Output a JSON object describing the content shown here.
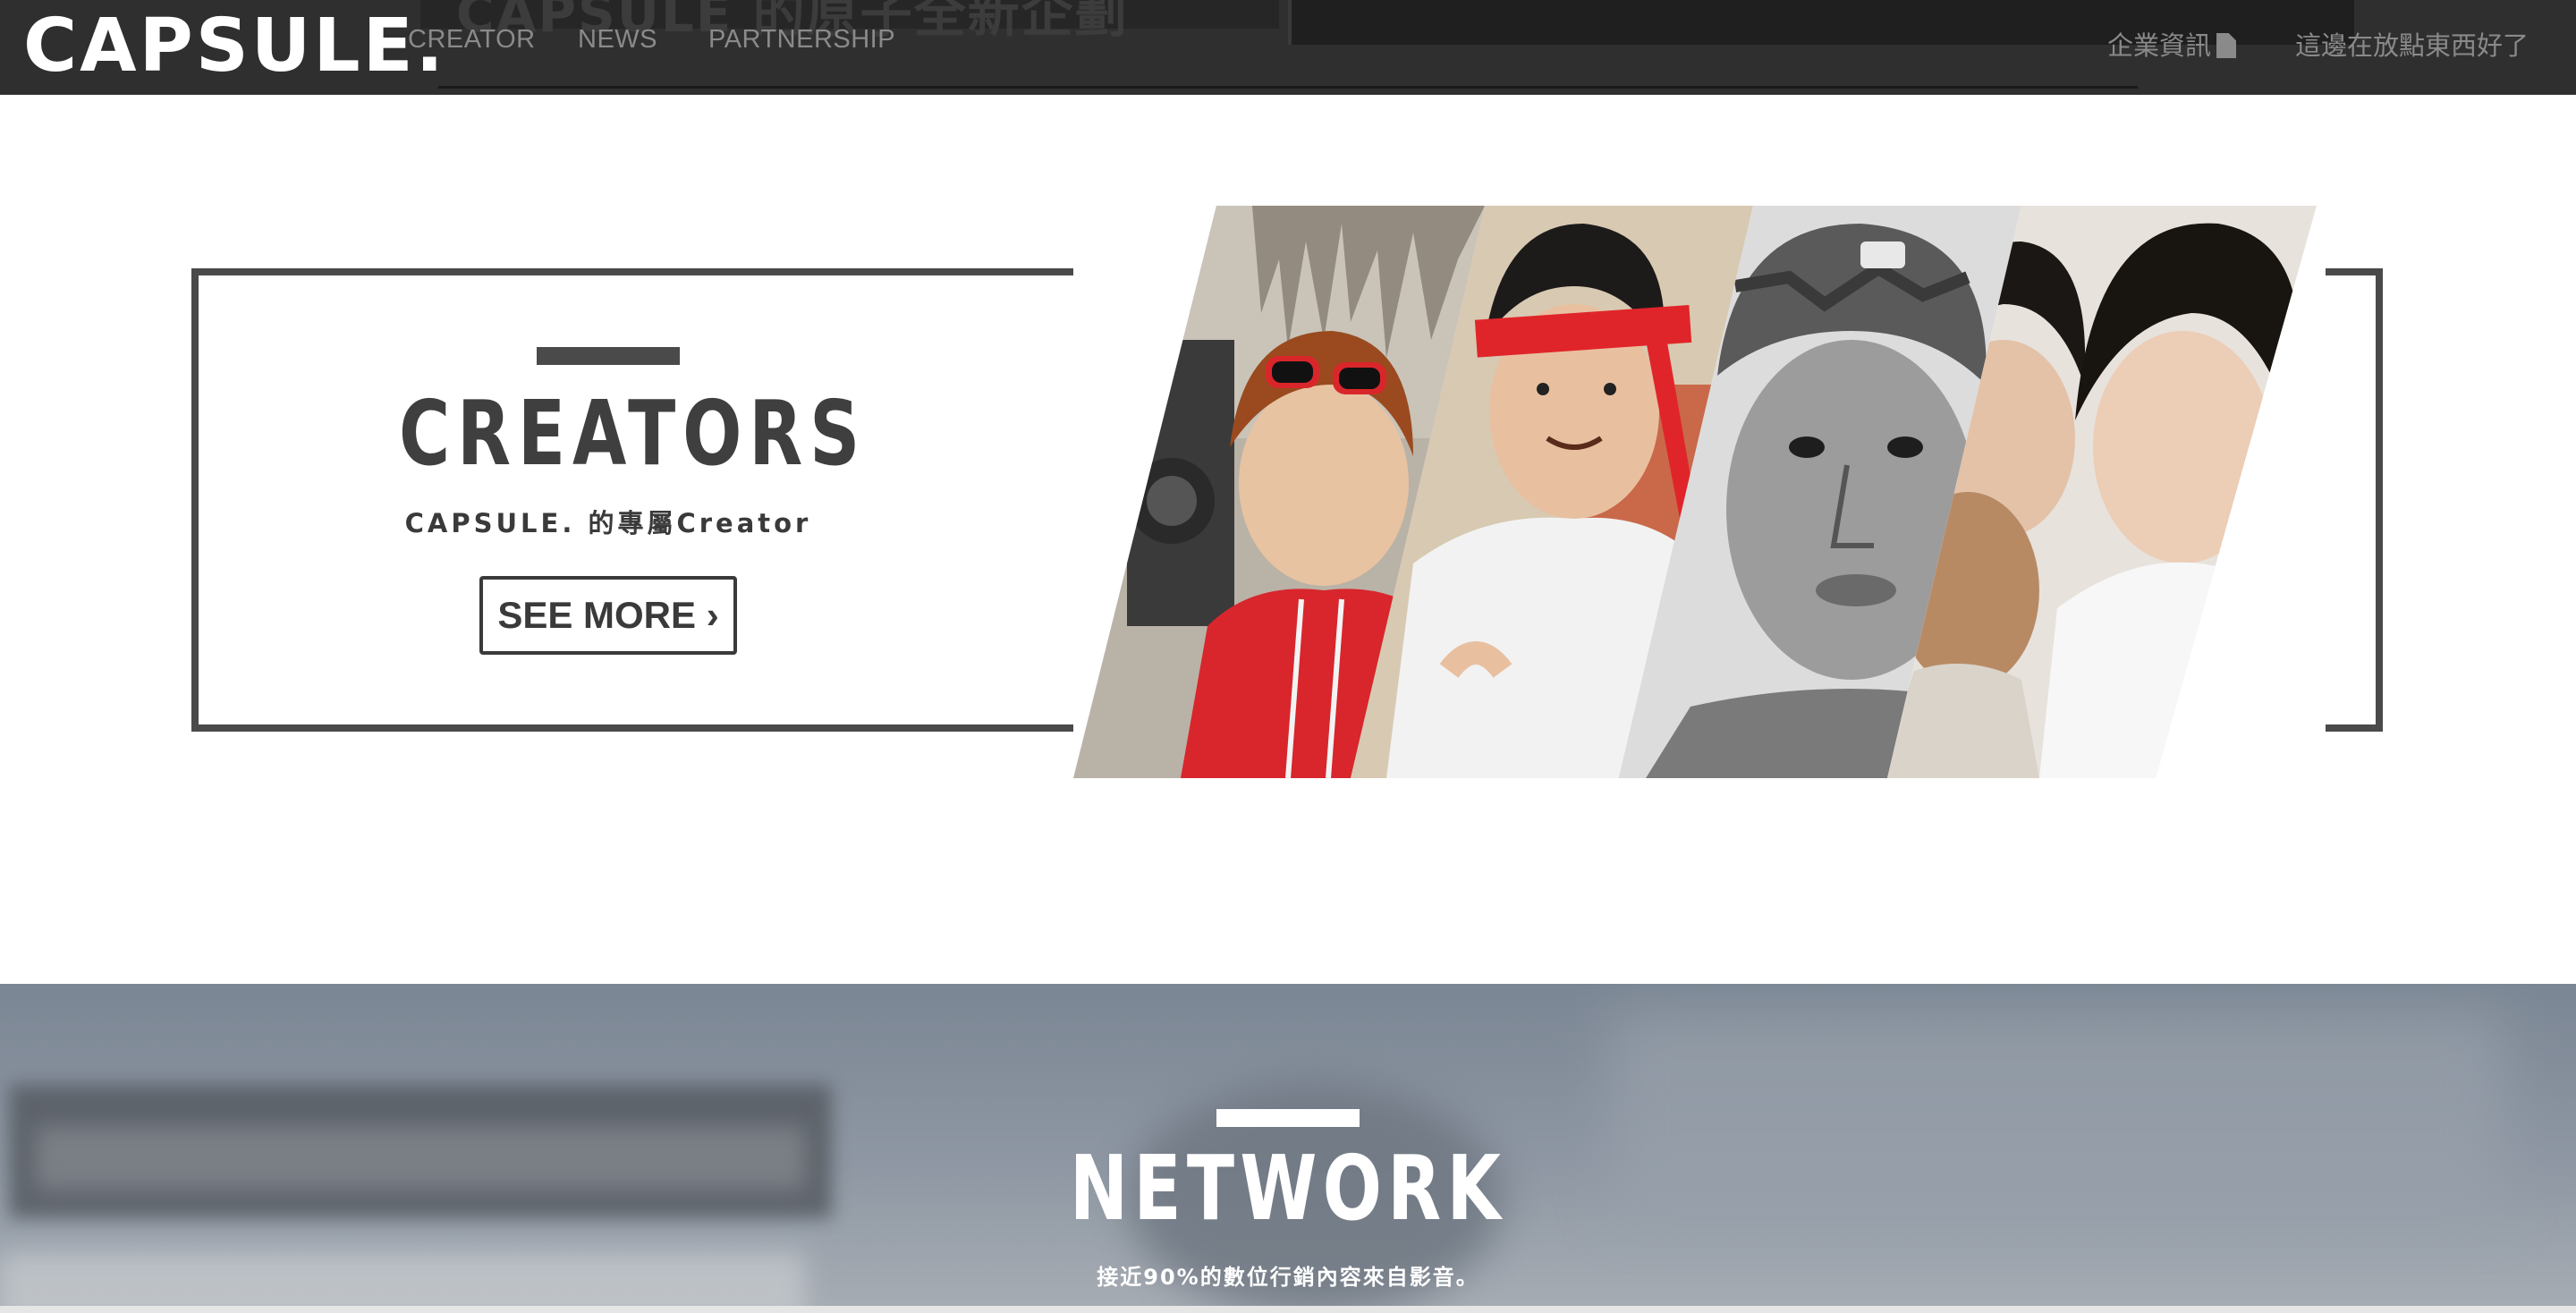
{
  "header": {
    "logo": "CAPSULE.",
    "nav": [
      "CREATOR",
      "NEWS",
      "PARTNERSHIP"
    ],
    "right_links": [
      "企業資訊",
      "這邊在放點東西好了"
    ],
    "banner_peek_text": "CAPSULE 的原子全新企劃"
  },
  "creators": {
    "title": "CREATORS",
    "subtitle": "CAPSULE. 的專屬Creator",
    "button": "SEE MORE ›"
  },
  "network": {
    "title": "NETWORK",
    "subtitle": "接近90%的數位行銷內容來自影音。"
  },
  "colors": {
    "nav_bg": "#2f2f2f",
    "frame": "#4a4a4a",
    "accent_red": "#d9262b"
  }
}
